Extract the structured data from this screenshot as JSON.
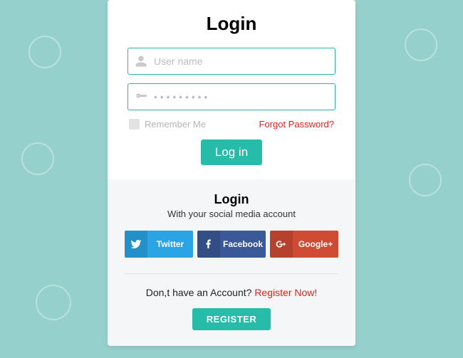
{
  "header": {
    "title": "Login"
  },
  "form": {
    "username_placeholder": "User name",
    "password_placeholder": "• • • • • • • • •",
    "remember_label": "Remember Me",
    "forgot_label": "Forgot Password?",
    "login_button": "Log in"
  },
  "social": {
    "title": "Login",
    "subtitle": "With your social media account",
    "twitter_label": "Twitter",
    "facebook_label": "Facebook",
    "google_label": "Google+"
  },
  "register": {
    "prompt": "Don,t have an Account? ",
    "link": "Register Now!",
    "button": "REGISTER"
  }
}
